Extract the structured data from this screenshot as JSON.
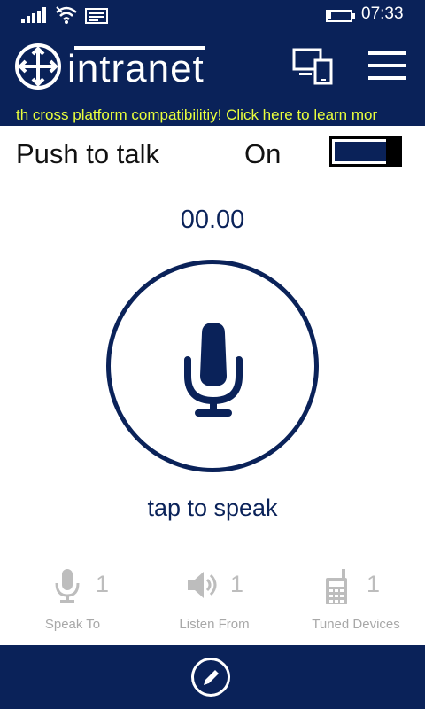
{
  "status": {
    "time": "07:33"
  },
  "header": {
    "logo_text": "intranet",
    "ticker": "th cross platform compatibilitiy! Click here to learn mor"
  },
  "ptt": {
    "label": "Push to talk",
    "state": "On",
    "enabled": true
  },
  "timer": "00.00",
  "main": {
    "tap_label": "tap to speak"
  },
  "stats": [
    {
      "icon": "microphone-icon",
      "count": "1",
      "label": "Speak To"
    },
    {
      "icon": "speaker-icon",
      "count": "1",
      "label": "Listen From"
    },
    {
      "icon": "walkie-talkie-icon",
      "count": "1",
      "label": "Tuned Devices"
    }
  ],
  "colors": {
    "navy": "#0a2259",
    "ticker": "#eaff3c",
    "muted": "#bdbdbd"
  }
}
